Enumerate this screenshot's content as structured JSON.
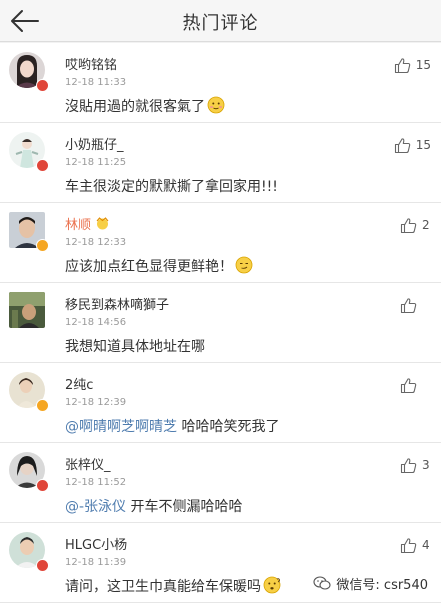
{
  "header": {
    "title": "热门评论",
    "back_icon": "back-arrow-icon"
  },
  "comments": [
    {
      "name": "哎哟铭铭",
      "time": "12-18 11:33",
      "text": "沒貼用過的就很客氣了",
      "emoji": "blush",
      "likes": "15",
      "badge": "red",
      "name_color": "default"
    },
    {
      "name": "小奶瓶仔_",
      "time": "12-18 11:25",
      "text": "车主很淡定的默默撕了拿回家用!!!",
      "emoji": "",
      "likes": "15",
      "badge": "red",
      "name_color": "default"
    },
    {
      "name": "林顺",
      "time": "12-18 12:33",
      "text": "应该加点红色显得更鲜艳！",
      "emoji": "smirk",
      "likes": "2",
      "badge": "orange",
      "name_color": "orange"
    },
    {
      "name": "移民到森林嘀獅子",
      "time": "12-18 14:56",
      "text": "我想知道具体地址在哪",
      "emoji": "",
      "likes": "",
      "badge": "none",
      "name_color": "default"
    },
    {
      "name": "2纯c",
      "time": "12-18 12:39",
      "mention": "@啊晴啊芝啊晴芝",
      "text": " 哈哈哈笑死我了",
      "emoji": "",
      "likes": "",
      "badge": "orange",
      "name_color": "default"
    },
    {
      "name": "张梓仪_",
      "time": "12-18 11:52",
      "mention": "@-张泳仪",
      "text": " 开车不侧漏哈哈哈",
      "emoji": "",
      "likes": "3",
      "badge": "red",
      "name_color": "default"
    },
    {
      "name": "HLGC小杨",
      "time": "12-18 11:39",
      "text": "请问，这卫生巾真能给车保暖吗",
      "emoji": "confused",
      "likes": "4",
      "badge": "red",
      "name_color": "default"
    }
  ],
  "watermark": {
    "text": "微信号: csr540"
  },
  "colors": {
    "badge_red": "#e0463a",
    "badge_orange": "#f5a623",
    "name_orange": "#eb7350",
    "mention_blue": "#507daf"
  }
}
